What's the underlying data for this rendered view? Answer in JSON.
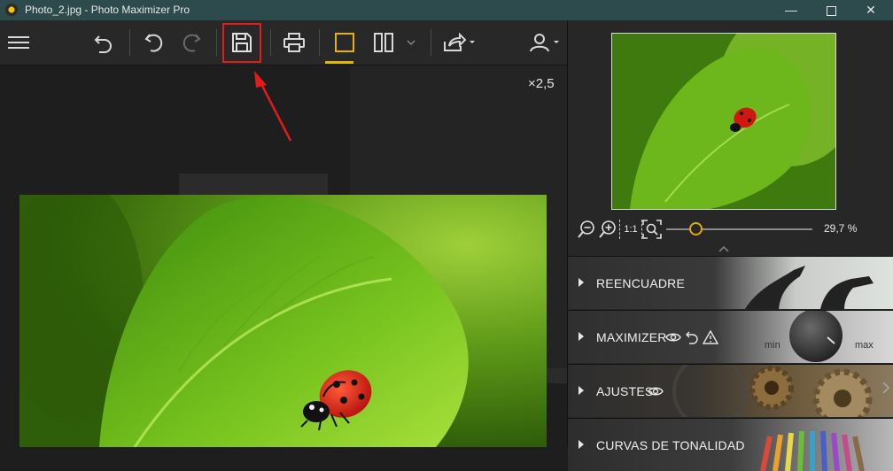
{
  "window": {
    "title": "Photo_2.jpg - Photo Maximizer Pro",
    "controls": {
      "minimize": "—",
      "close": "✕"
    }
  },
  "toolbar": {
    "items": [
      "menu-icon",
      "open-icon",
      "undo-icon",
      "redo-icon",
      "save-icon",
      "print-icon",
      "single-view-icon",
      "split-view-icon",
      "share-icon",
      "user-icon"
    ],
    "save_highlight_color": "#e31b1b",
    "active_view_color": "#e4b400"
  },
  "canvas": {
    "zoom_factor": "×2,5"
  },
  "navigator": {
    "zoom_percent": "29,7 %",
    "zoom_slider_level": 0.2,
    "fit_label": "1:1"
  },
  "sections": [
    {
      "label": "REENCUADRE"
    },
    {
      "label": "MAXIMIZER",
      "min_label": "min",
      "max_label": "max"
    },
    {
      "label": "AJUSTES"
    },
    {
      "label": "CURVAS DE TONALIDAD"
    }
  ]
}
